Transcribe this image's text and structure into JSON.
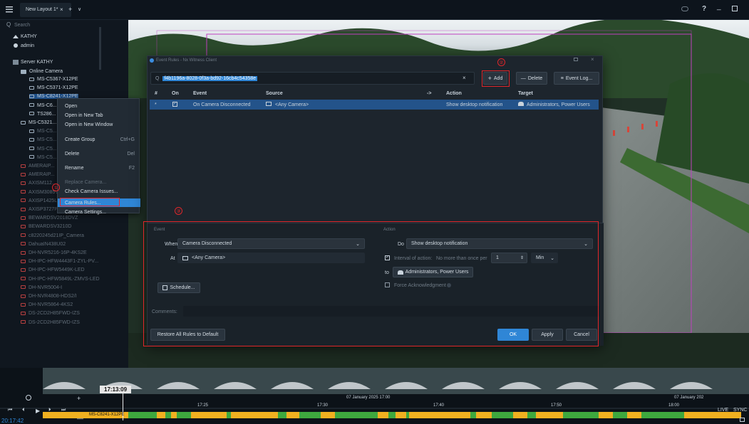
{
  "topbar": {
    "tab_label": "New Layout 1*",
    "close_tab": "×",
    "new_tab": "+",
    "tab_dropdown": "∨",
    "help": "?",
    "minimize": "_"
  },
  "sidebar": {
    "search_placeholder": "Search",
    "site": "KATHY",
    "user": "admin",
    "server": "Server KATHY",
    "group": "Online Camera",
    "cameras": [
      "MS-C5367-X12PE",
      "MS-C5371-X12PE",
      "MS-C8241-X12PE",
      "MS-C6...",
      "TS286...",
      "MS-C5321...",
      "MS-C5...",
      "MS-C5...",
      "MS-C5...",
      "MS-C5...",
      "AMERAIP...",
      "AMERAIP...",
      "AXISM112...",
      "AXISM3085V",
      "AXISP1425LE",
      "AXISP3727PLE",
      "BEWARDSV2018DVZ",
      "BEWARDSV3210D",
      "c8220245d21IP_Camera",
      "DahuaIN438U02",
      "DH-NVR5216-16P-4KS2E",
      "DH-IPC-HFW4443F1-ZYL-PV...",
      "DH-IPC-HFW5449K-LED",
      "DH-IPC-HFW5849L-ZMVS-LED",
      "DH-NVR5004-I",
      "DH-NVR4808-HDS2/I",
      "DH-NVR5864-4KS2",
      "DS-2CD2H85FWD-IZS",
      "DS-2CD2H85FWD-IZS"
    ]
  },
  "context_menu": {
    "items": [
      {
        "label": "Open",
        "shortcut": ""
      },
      {
        "label": "Open in New Tab",
        "shortcut": ""
      },
      {
        "label": "Open in New Window",
        "shortcut": ""
      },
      {
        "label": "Create Group",
        "shortcut": "Ctrl+G"
      },
      {
        "label": "Delete",
        "shortcut": "Del"
      },
      {
        "label": "Rename",
        "shortcut": "F2"
      },
      {
        "label": "Replace Camera...",
        "shortcut": ""
      },
      {
        "label": "Check Camera Issues...",
        "shortcut": ""
      },
      {
        "label": "Camera Rules...",
        "shortcut": ""
      },
      {
        "label": "Camera Settings...",
        "shortcut": ""
      }
    ]
  },
  "annotations": {
    "one": "①",
    "two": "②",
    "three": "③"
  },
  "dialog": {
    "title": "Event Rules - Nx Witness Client",
    "filter_value": "f4b1196a-8028-0f3a-bd92-16cb4c54358e",
    "clear": "×",
    "add": "Add",
    "delete": "Delete",
    "event_log": "Event Log...",
    "columns": {
      "num": "#",
      "on": "On",
      "event": "Event",
      "source": "Source",
      "arrow": "->",
      "action": "Action",
      "target": "Target"
    },
    "row": {
      "num": "*",
      "event": "On Camera Disconnected",
      "source": "<Any Camera>",
      "action": "Show desktop notification",
      "target": "Administrators, Power Users"
    },
    "event_section": "Event",
    "when_label": "When",
    "when_value": "Camera Disconnected",
    "at_label": "At",
    "at_value": "<Any Camera>",
    "schedule": "Schedule...",
    "action_section": "Action",
    "do_label": "Do",
    "do_value": "Show desktop notification",
    "interval_label": "Interval of action:",
    "interval_text": "No more than once per",
    "interval_value": "1",
    "interval_unit": "Min",
    "to_label": "to",
    "to_value": "Administrators, Power Users",
    "force_ack": "Force Acknowledgment",
    "comments_label": "Comments:",
    "restore": "Restore All Rules to Default",
    "ok": "OK",
    "apply": "Apply",
    "cancel": "Cancel"
  },
  "timeline": {
    "current_time": "17:13:09",
    "clock": "20:17:42",
    "camera": "MS-C8241-X12PE",
    "date_label": "07 January 2025 17:00",
    "date_label_right": "07 January 202",
    "ticks": [
      "17:25",
      "17:30",
      "17:40",
      "17:50",
      "18:00"
    ],
    "live": "LIVE",
    "sync": "SYNC"
  },
  "colors": {
    "accent": "#2f86d6",
    "annotation": "#e0262a",
    "timeline_yellow": "#f0b020",
    "timeline_green": "#3ea83e"
  }
}
